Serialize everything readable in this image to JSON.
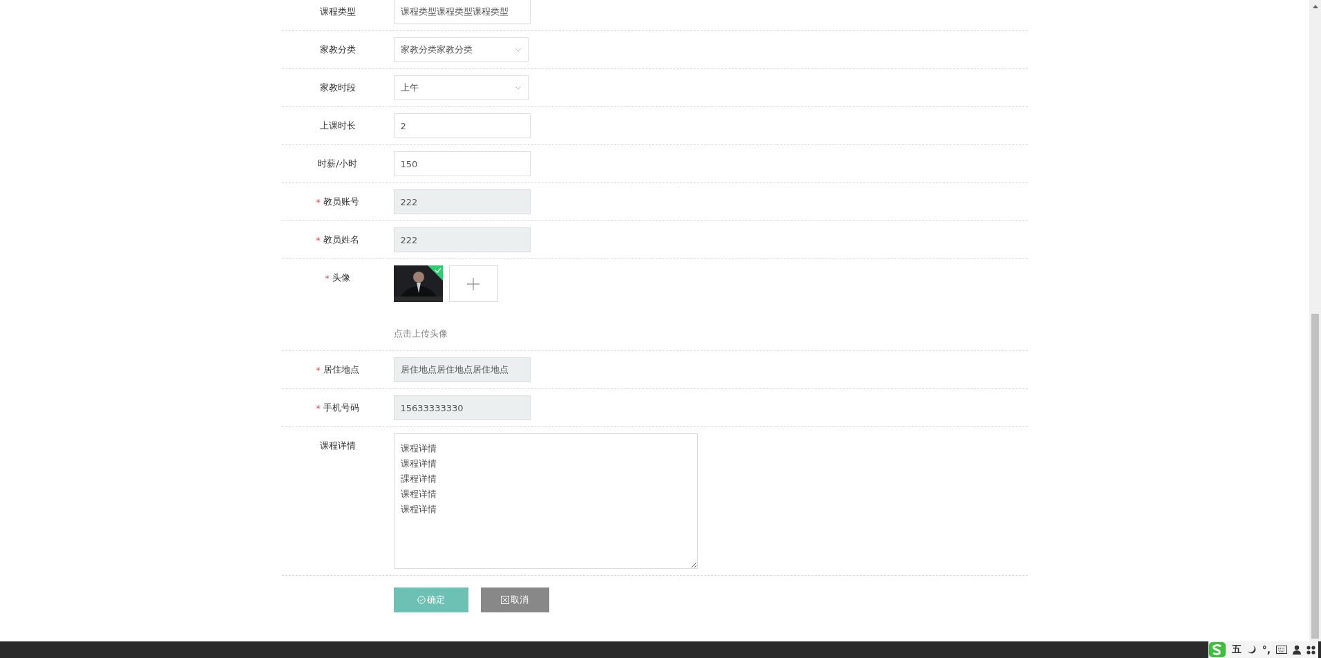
{
  "form": {
    "fields": [
      {
        "kind": "input",
        "label": "课程类型",
        "value": "课程类型课程类型课程类型",
        "readonly": false
      },
      {
        "kind": "select",
        "label": "家教分类",
        "value": "家教分类家教分类"
      },
      {
        "kind": "select",
        "label": "家教时段",
        "value": "上午"
      },
      {
        "kind": "input",
        "label": "上课时长",
        "value": "2",
        "readonly": false
      },
      {
        "kind": "input",
        "label": "时薪/小时",
        "value": "150",
        "readonly": false
      },
      {
        "kind": "input",
        "label": "教员账号",
        "required_mark": "*",
        "value": "222",
        "readonly": true
      },
      {
        "kind": "input",
        "label": "教员姓名",
        "required_mark": "*",
        "value": "222",
        "readonly": true
      },
      {
        "kind": "avatar",
        "label": "头像",
        "required_mark": "*",
        "uploaded": true,
        "hint": "点击上传头像"
      },
      {
        "kind": "input",
        "label": "居住地点",
        "required_mark": "*",
        "value": "居住地点居住地点居住地点",
        "readonly": true
      },
      {
        "kind": "input",
        "label": "手机号码",
        "required_mark": "*",
        "value": "15633333330",
        "readonly": true
      },
      {
        "kind": "textarea",
        "label": "课程详情",
        "lines": [
          "课程详情",
          "课程详情",
          "課程详情",
          "课程详情",
          "课程详情"
        ]
      }
    ],
    "buttons": [
      {
        "kind": "confirm",
        "label": "确定"
      },
      {
        "kind": "cancel",
        "label": "取消"
      }
    ]
  },
  "taskbar": {
    "ime_mode": "五",
    "punctuation": "°,"
  }
}
